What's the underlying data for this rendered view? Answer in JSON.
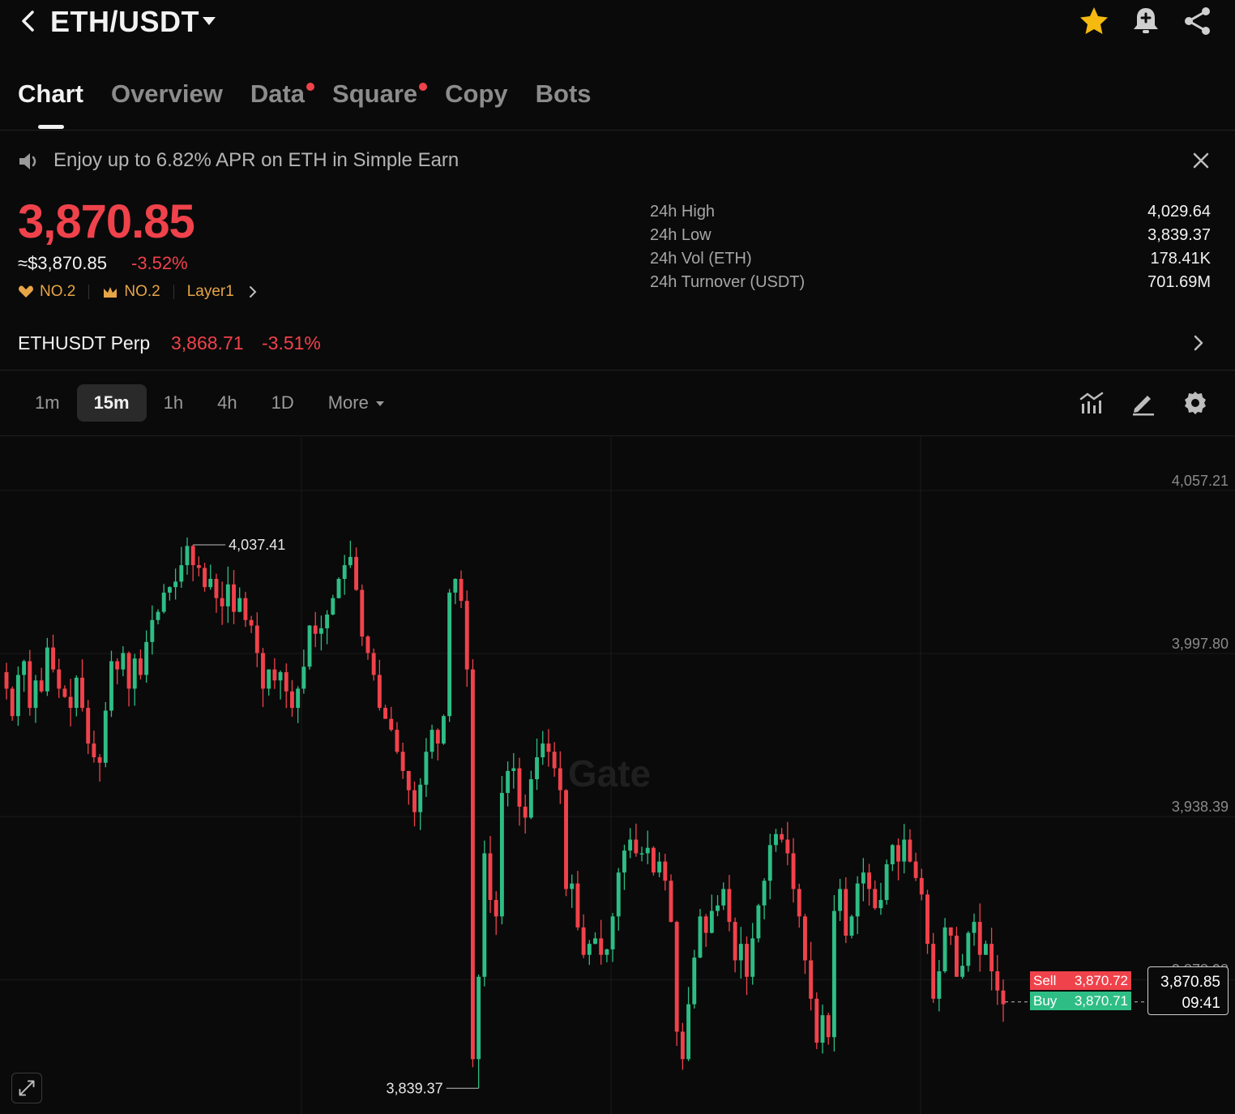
{
  "header": {
    "pair": "ETH/USDT"
  },
  "tabs": [
    {
      "label": "Chart",
      "active": true,
      "dot": false
    },
    {
      "label": "Overview",
      "active": false,
      "dot": false
    },
    {
      "label": "Data",
      "active": false,
      "dot": true
    },
    {
      "label": "Square",
      "active": false,
      "dot": true
    },
    {
      "label": "Copy",
      "active": false,
      "dot": false
    },
    {
      "label": "Bots",
      "active": false,
      "dot": false
    }
  ],
  "promo": {
    "text": "Enjoy up to 6.82% APR on ETH in Simple Earn"
  },
  "ticker": {
    "price": "3,870.85",
    "usd_approx": "≈$3,870.85",
    "change": "-3.52%",
    "badges": [
      "NO.2",
      "NO.2",
      "Layer1"
    ]
  },
  "stats": [
    {
      "label": "24h High",
      "value": "4,029.64"
    },
    {
      "label": "24h Low",
      "value": "3,839.37"
    },
    {
      "label": "24h Vol (ETH)",
      "value": "178.41K"
    },
    {
      "label": "24h Turnover (USDT)",
      "value": "701.69M"
    }
  ],
  "perp": {
    "name": "ETHUSDT Perp",
    "price": "3,868.71",
    "change": "-3.51%"
  },
  "intervals": {
    "items": [
      "1m",
      "15m",
      "1h",
      "4h",
      "1D"
    ],
    "active": "15m",
    "more_label": "More"
  },
  "colors": {
    "up": "#2ebd85",
    "down": "#f0424b",
    "accent_star": "#f5b90f",
    "badge": "#e7a546"
  },
  "chart_data": {
    "type": "candlestick",
    "interval": "15m",
    "y_ticks": [
      4057.21,
      3997.8,
      3938.39,
      3878.98
    ],
    "y_tick_labels": [
      "4,057.21",
      "3,997.80",
      "3,938.39",
      "3,878.98"
    ],
    "ylim": [
      3830,
      4077
    ],
    "high_marker": {
      "value": 4037.41,
      "label": "4,037.41"
    },
    "low_marker": {
      "value": 3839.37,
      "label": "3,839.37"
    },
    "sell": {
      "label": "Sell",
      "value": "3,870.72"
    },
    "buy": {
      "label": "Buy",
      "value": "3,870.71"
    },
    "current": {
      "price": "3,870.85",
      "countdown": "09:41"
    },
    "watermark": "Gate",
    "closes": [
      3985,
      3975,
      3990,
      3995,
      3978,
      3988,
      3984,
      4000,
      3992,
      3985,
      3982,
      3978,
      3989,
      3978,
      3965,
      3960,
      3958,
      3977,
      3995,
      3992,
      3998,
      3985,
      3996,
      3990,
      4002,
      4010,
      4013,
      4020,
      4022,
      4024,
      4030,
      4037,
      4030,
      4029,
      4022,
      4025,
      4018,
      4015,
      4023,
      4013,
      4018,
      4010,
      4008,
      3998,
      3985,
      3992,
      3988,
      3991,
      3984,
      3978,
      3985,
      3993,
      4008,
      4005,
      4007,
      4012,
      4018,
      4025,
      4030,
      4033,
      4021,
      4004,
      3998,
      3990,
      3978,
      3974,
      3970,
      3962,
      3955,
      3948,
      3940,
      3950,
      3962,
      3970,
      3965,
      3975,
      4020,
      4025,
      4017,
      3992,
      3850,
      3880,
      3925,
      3908,
      3902,
      3947,
      3955,
      3956,
      3942,
      3938,
      3952,
      3960,
      3965,
      3962,
      3956,
      3948,
      3912,
      3914,
      3898,
      3888,
      3892,
      3894,
      3888,
      3890,
      3902,
      3918,
      3926,
      3930,
      3925,
      3925,
      3927,
      3918,
      3922,
      3915,
      3900,
      3860,
      3850,
      3870,
      3887,
      3902,
      3896,
      3904,
      3906,
      3912,
      3900,
      3886,
      3892,
      3880,
      3894,
      3906,
      3915,
      3928,
      3932,
      3930,
      3925,
      3912,
      3902,
      3886,
      3872,
      3856,
      3866,
      3858,
      3904,
      3912,
      3895,
      3902,
      3914,
      3918,
      3912,
      3905,
      3908,
      3921,
      3928,
      3922,
      3930,
      3922,
      3916,
      3910,
      3892,
      3872,
      3882,
      3898,
      3895,
      3880,
      3884,
      3896,
      3900,
      3888,
      3892,
      3882,
      3875,
      3870
    ]
  }
}
